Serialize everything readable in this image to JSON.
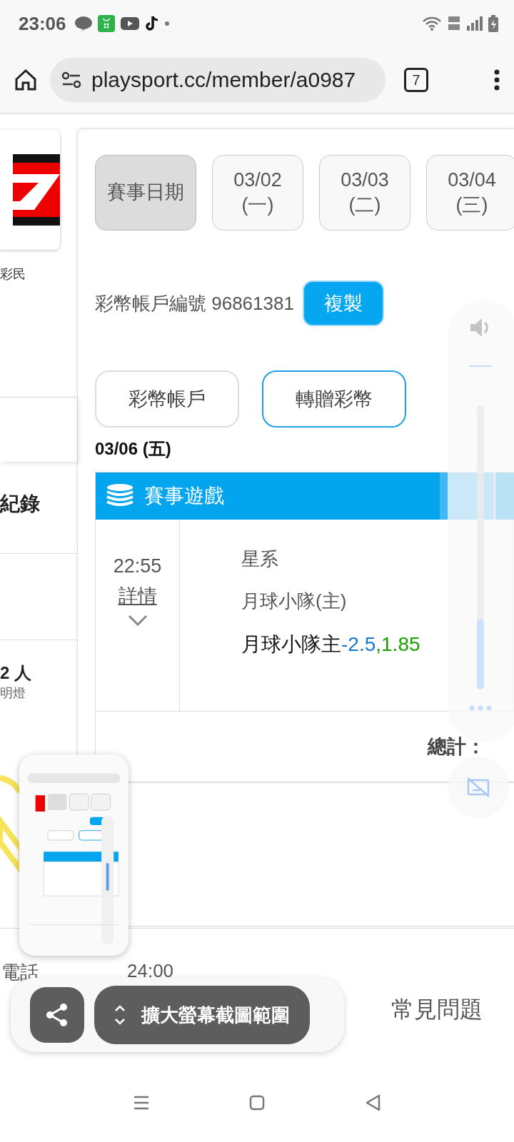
{
  "status_bar": {
    "time": "23:06"
  },
  "browser": {
    "url": "playsport.cc/member/a0987",
    "tab_count": "7"
  },
  "sidebar": {
    "member_label": "彩民",
    "section_title": "紀錄",
    "count": "2 人",
    "caption": "明燈"
  },
  "date_tabs": [
    {
      "lines": [
        "賽事日期"
      ],
      "selected": true
    },
    {
      "lines": [
        "03/02",
        "(一)"
      ],
      "selected": false
    },
    {
      "lines": [
        "03/03",
        "(二)"
      ],
      "selected": false
    },
    {
      "lines": [
        "03/04",
        "(三)"
      ],
      "selected": false
    }
  ],
  "account": {
    "label": "彩幣帳戶編號 96861381",
    "copy_button": "複製"
  },
  "actions": [
    {
      "label": "彩幣帳戶",
      "selected": false
    },
    {
      "label": "轉贈彩幣",
      "selected": true
    }
  ],
  "day_heading": "03/06 (五)",
  "table": {
    "title": "賽事遊戲",
    "rows": [
      {
        "time": "22:55",
        "detail_link": "詳情",
        "league": "星系",
        "team": "月球小隊(主)",
        "pick": "月球小隊主",
        "line": "-2.5",
        "odds": ",1.85"
      }
    ],
    "total_label": "總計："
  },
  "footer": {
    "hours_label": "電話",
    "hours": "24:00",
    "faq": "常見問題"
  },
  "volume_panel": {
    "level": 0.25
  },
  "screenshot_toolbar": {
    "expand_label": "擴大螢幕截圖範圍"
  }
}
